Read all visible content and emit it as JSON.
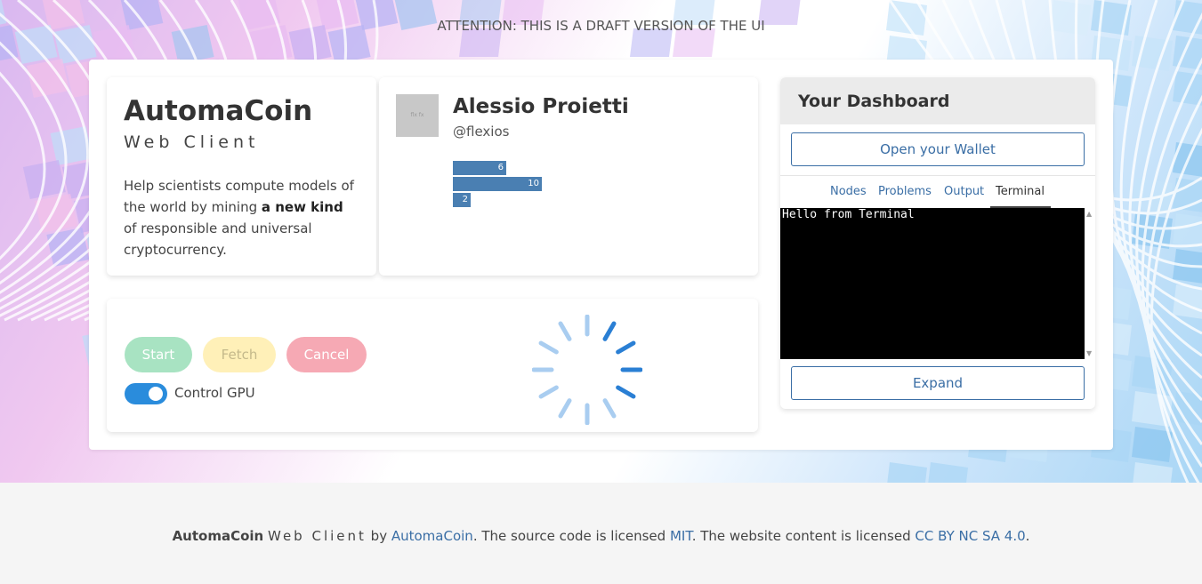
{
  "banner": "ATTENTION: THIS IS A DRAFT VERSION OF THE UI",
  "intro": {
    "title": "AutomaCoin",
    "subtitle": "Web Client",
    "desc_before": "Help scientists compute models of the world by mining ",
    "desc_bold": "a new kind",
    "desc_after": " of responsible and universal cryptocurrency."
  },
  "profile": {
    "name": "Alessio Proietti",
    "handle": "@flexios",
    "avatar_text": "flx fx",
    "bars": [
      6,
      10,
      2
    ]
  },
  "controls": {
    "start": "Start",
    "fetch": "Fetch",
    "cancel": "Cancel",
    "gpu_label": "Control GPU",
    "gpu_on": true
  },
  "dashboard": {
    "title": "Your Dashboard",
    "open_wallet": "Open your Wallet",
    "tabs": [
      "Nodes",
      "Problems",
      "Output",
      "Terminal"
    ],
    "active_tab": "Terminal",
    "terminal_text": "Hello from Terminal",
    "expand": "Expand"
  },
  "footer": {
    "brand": "AutomaCoin",
    "subtitle": "Web Client",
    "by": " by ",
    "author_link": "AutomaCoin",
    "source_text": ". The source code is licensed ",
    "mit_link": "MIT",
    "content_text": ". The website content is licensed ",
    "cc_link": "CC BY NC SA 4.0",
    "end": "."
  },
  "colors": {
    "accent": "#3a6ea5",
    "start": "#a8e3c2",
    "fetch": "#fff0b8",
    "cancel": "#f6a9b4",
    "toggle": "#2a8cdc"
  }
}
